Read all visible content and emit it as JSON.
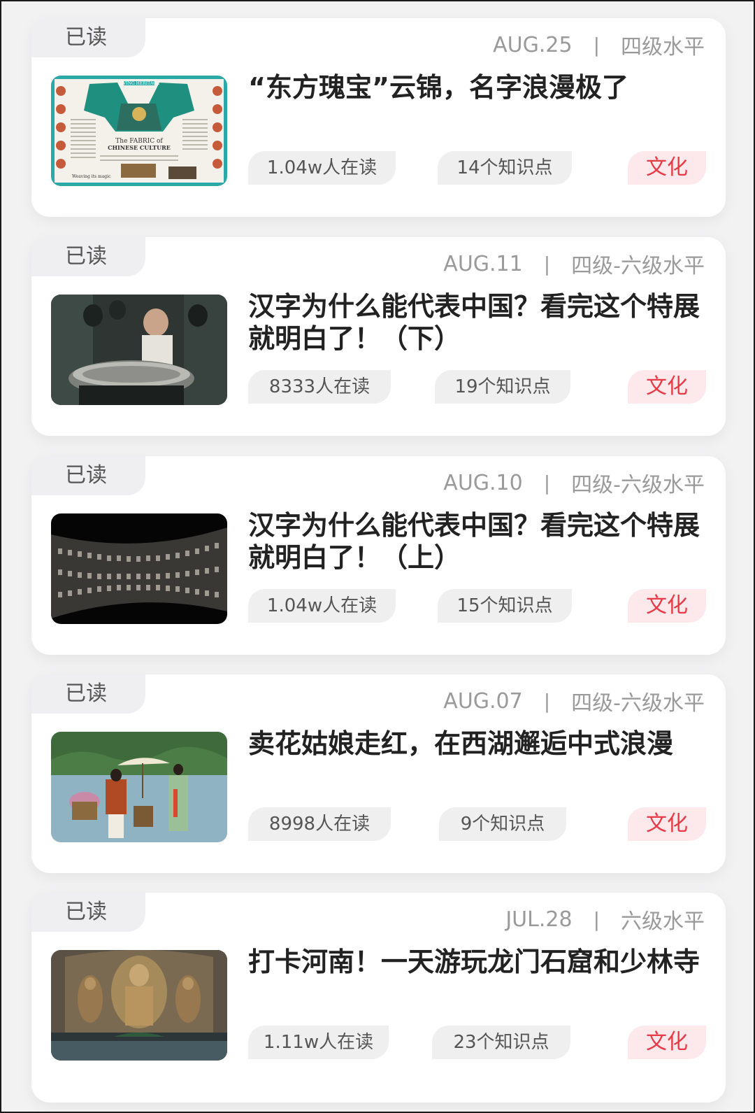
{
  "articles": [
    {
      "read_label": "已读",
      "date": "AUG.25",
      "level": "四级水平",
      "title": "“东方瑰宝”云锦，名字浪漫极了",
      "readers": "1.04w人在读",
      "knowledge_points": "14个知识点",
      "category": "文化",
      "thumbnail": "newspaper-fabric-of-chinese-culture"
    },
    {
      "read_label": "已读",
      "date": "AUG.11",
      "level": "四级-六级水平",
      "title": "汉字为什么能代表中国？看完这个特展就明白了！（下）",
      "readers": "8333人在读",
      "knowledge_points": "19个知识点",
      "category": "文化",
      "thumbnail": "museum-bronze-vessel"
    },
    {
      "read_label": "已读",
      "date": "AUG.10",
      "level": "四级-六级水平",
      "title": "汉字为什么能代表中国？看完这个特展就明白了！（上）",
      "readers": "1.04w人在读",
      "knowledge_points": "15个知识点",
      "category": "文化",
      "thumbnail": "character-wall-exhibit"
    },
    {
      "read_label": "已读",
      "date": "AUG.07",
      "level": "四级-六级水平",
      "title": "卖花姑娘走红，在西湖邂逅中式浪漫",
      "readers": "8998人在读",
      "knowledge_points": "9个知识点",
      "category": "文化",
      "thumbnail": "west-lake-flower-girls"
    },
    {
      "read_label": "已读",
      "date": "JUL.28",
      "level": "六级水平",
      "title": "打卡河南！一天游玩龙门石窟和少林寺",
      "readers": "1.11w人在读",
      "knowledge_points": "23个知识点",
      "category": "文化",
      "thumbnail": "longmen-grottoes"
    }
  ],
  "thumb_text": {
    "masthead": "LIVING HERITAGE",
    "headline_1": "The FABRIC of",
    "headline_2": "CHINESE CULTURE",
    "caption": "Weaving its magic"
  },
  "colors": {
    "category_text": "#e83a46",
    "category_bg": "#fde9ec",
    "tag_bg": "#efeff0",
    "meta_text": "#9a9a9a"
  }
}
